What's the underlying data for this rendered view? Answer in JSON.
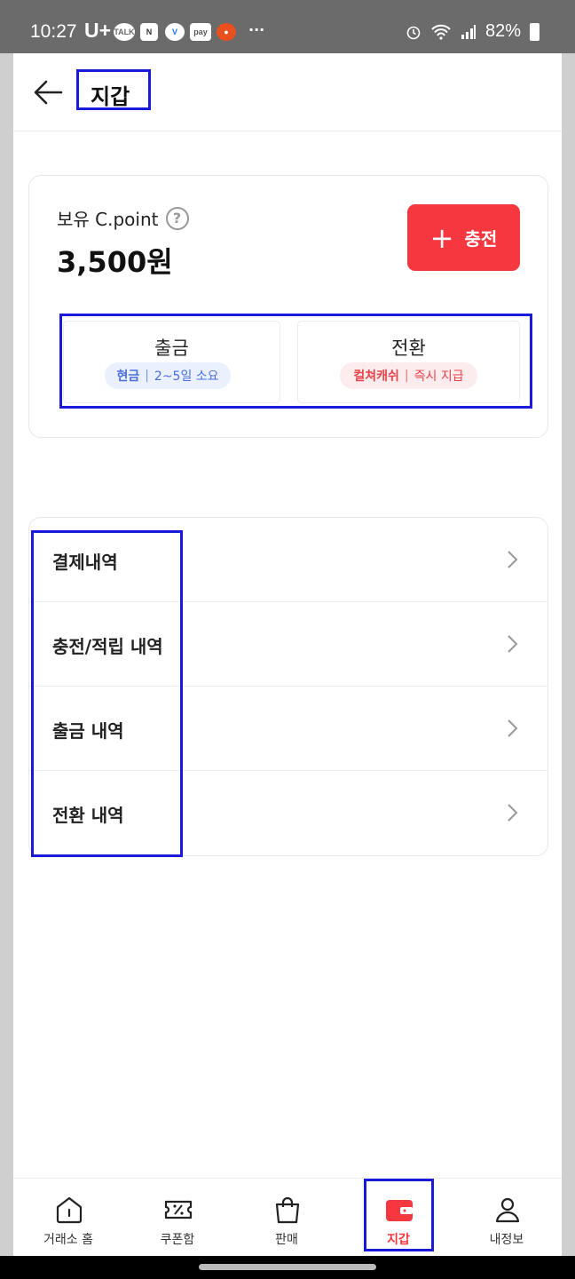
{
  "status_bar": {
    "time": "10:27",
    "carrier": "U+",
    "app_icons": [
      "TALK",
      "N",
      "V",
      "pay",
      "●"
    ],
    "more": "···",
    "battery": "82%"
  },
  "header": {
    "title": "지갑",
    "back_icon": "arrow-left-icon"
  },
  "wallet": {
    "label": "보유 C.point",
    "help": "?",
    "amount": "3,500원",
    "charge_plus": "+",
    "charge_label": "충전",
    "accent_color": "#f5373f",
    "actions": [
      {
        "name": "출금",
        "tag_strong": "현금",
        "sep": "|",
        "tag": "2~5일 소요"
      },
      {
        "name": "전환",
        "tag_strong": "컬쳐캐쉬",
        "sep": "|",
        "tag": "즉시 지급"
      }
    ]
  },
  "menu": {
    "items": [
      {
        "label": "결제내역"
      },
      {
        "label": "충전/적립 내역"
      },
      {
        "label": "출금 내역"
      },
      {
        "label": "전환 내역"
      }
    ]
  },
  "tabs": {
    "active_index": 3,
    "items": [
      {
        "label": "거래소 홈",
        "icon": "home-icon"
      },
      {
        "label": "쿠폰함",
        "icon": "coupon-icon"
      },
      {
        "label": "판매",
        "icon": "shopping-bag-icon"
      },
      {
        "label": "지갑",
        "icon": "wallet-icon"
      },
      {
        "label": "내정보",
        "icon": "user-icon"
      }
    ]
  }
}
